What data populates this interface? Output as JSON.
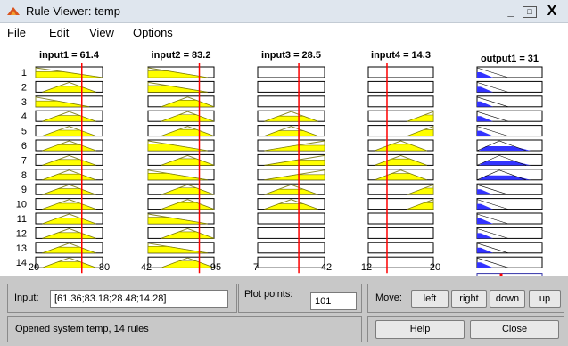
{
  "window": {
    "title": "Rule Viewer: temp",
    "min_symbol": "_",
    "max_symbol": "□",
    "close_symbol": "X"
  },
  "menu": [
    "File",
    "Edit",
    "View",
    "Options"
  ],
  "rules": {
    "count": 14,
    "labels": [
      "1",
      "2",
      "3",
      "4",
      "5",
      "6",
      "7",
      "8",
      "9",
      "10",
      "11",
      "12",
      "13",
      "14"
    ]
  },
  "inputs": [
    {
      "title": "input1 = 61.4",
      "value": 61.4,
      "range": [
        20,
        80
      ],
      "min_label": "20",
      "max_label": "80"
    },
    {
      "title": "input2 = 83.2",
      "value": 83.2,
      "range": [
        42,
        95
      ],
      "min_label": "42",
      "max_label": "95"
    },
    {
      "title": "input3 = 28.5",
      "value": 28.5,
      "range": [
        7,
        42
      ],
      "min_label": "7",
      "max_label": "42"
    },
    {
      "title": "input4 = 14.3",
      "value": 14.3,
      "range": [
        12,
        20
      ],
      "min_label": "12",
      "max_label": "20"
    }
  ],
  "output": {
    "title": "output1 = 31",
    "value": 31,
    "aggregate_marker_fraction": 0.37
  },
  "controls": {
    "input_label": "Input:",
    "input_value": "[61.36;83.18;28.48;14.28]",
    "plot_points_label": "Plot points:",
    "plot_points_value": "101",
    "move_label": "Move:",
    "move_buttons": [
      "left",
      "right",
      "down",
      "up"
    ],
    "status": "Opened system temp, 14 rules",
    "help_label": "Help",
    "close_label": "Close"
  },
  "colors": {
    "input_fill": "#ffff00",
    "output_fill": "#3333ff",
    "indicator": "#ff0000",
    "panel": "#c8c8c8"
  },
  "icons": {
    "app": "matlab-icon"
  }
}
